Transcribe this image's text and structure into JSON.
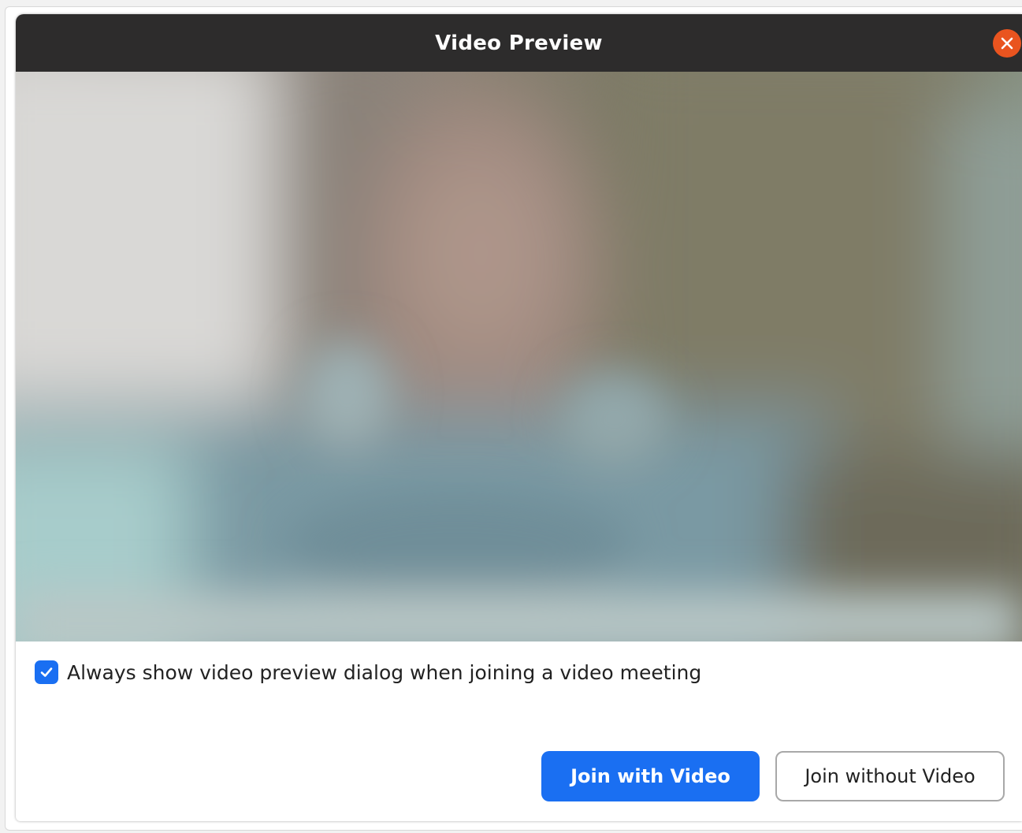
{
  "window": {
    "title": "Video Preview",
    "close_icon": "close-icon",
    "close_color": "#e9541f"
  },
  "preview": {
    "description_icon": "camera-feed"
  },
  "option": {
    "checked": true,
    "label": "Always show video preview dialog when joining a video meeting"
  },
  "buttons": {
    "join_with_video": "Join with Video",
    "join_without_video": "Join without Video",
    "primary_color": "#1a6ff2"
  }
}
